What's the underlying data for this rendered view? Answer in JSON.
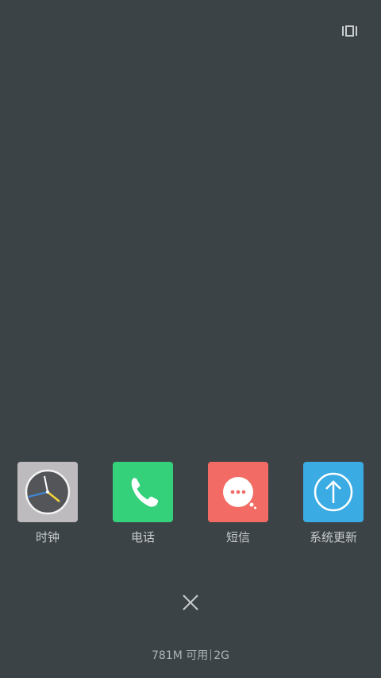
{
  "toolbar": {
    "view_toggle_icon": "recent-apps-view-icon"
  },
  "apps": [
    {
      "label": "时钟",
      "icon": "clock-icon",
      "color": "#bdbbbd"
    },
    {
      "label": "电话",
      "icon": "phone-icon",
      "color": "#35d07a"
    },
    {
      "label": "短信",
      "icon": "message-icon",
      "color": "#f26b64"
    },
    {
      "label": "系统更新",
      "icon": "system-update-icon",
      "color": "#3aabe3"
    }
  ],
  "close": {
    "icon": "close-icon"
  },
  "memory": {
    "available": "781M 可用",
    "total": "2G"
  },
  "colors": {
    "background": "#3c4346",
    "label_text": "#c7cbcc"
  }
}
